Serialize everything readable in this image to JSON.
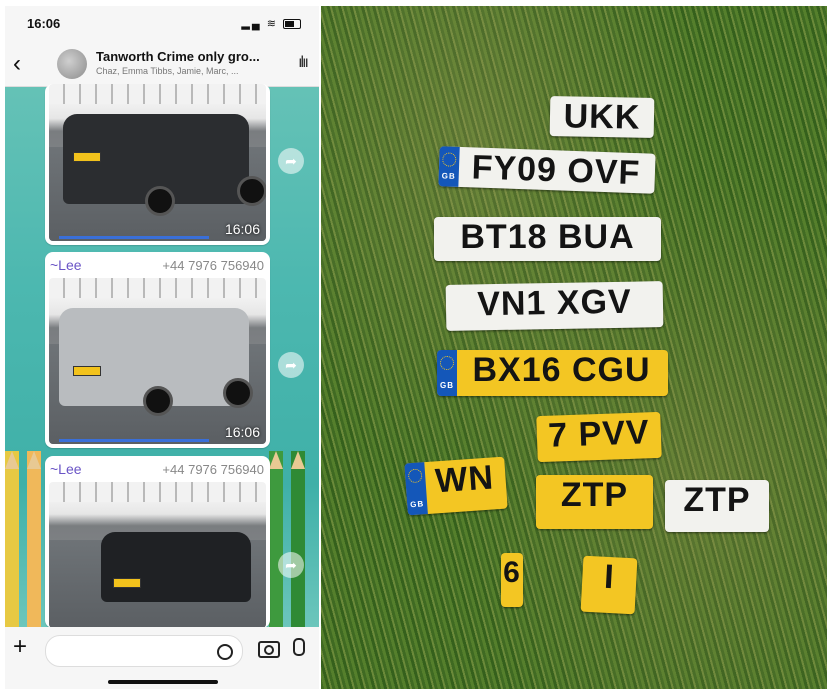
{
  "status_bar": {
    "time": "16:06"
  },
  "chat": {
    "title": "Tanworth Crime  only gro...",
    "subtitle": "Chaz, Emma Tibbs, Jamie, Marc, ..."
  },
  "messages": [
    {
      "timestamp": "16:06"
    },
    {
      "sender": "~Lee",
      "phone": "+44 7976 756940",
      "timestamp": "16:06"
    },
    {
      "sender": "~Lee",
      "phone": "+44 7976 756940"
    }
  ],
  "plates": [
    {
      "text": "UKK",
      "color": "white"
    },
    {
      "text": "FY09 OVF",
      "color": "white",
      "country": "GB"
    },
    {
      "text": "BT18 BUA",
      "color": "white"
    },
    {
      "text": "VN1 XGV",
      "color": "white"
    },
    {
      "text": "BX16 CGU",
      "color": "yellow",
      "country": "GB"
    },
    {
      "text": "7 PVV",
      "color": "yellow"
    },
    {
      "text": "WN",
      "color": "yellow",
      "country": "GB"
    },
    {
      "text": "ZTP",
      "color": "yellow"
    },
    {
      "text": "ZTP",
      "color": "white"
    },
    {
      "text": "6",
      "color": "yellow"
    },
    {
      "text": "I",
      "color": "yellow"
    }
  ],
  "colors": {
    "whatsapp_sender": "#6a54c6",
    "plate_yellow": "#f3c623",
    "plate_white": "#f2f2ee",
    "eu_blue": "#1457b9"
  },
  "icons": [
    "back-icon",
    "waveform-icon",
    "forward-icon",
    "plus-icon",
    "sticker-icon",
    "camera-icon",
    "microphone-icon"
  ]
}
